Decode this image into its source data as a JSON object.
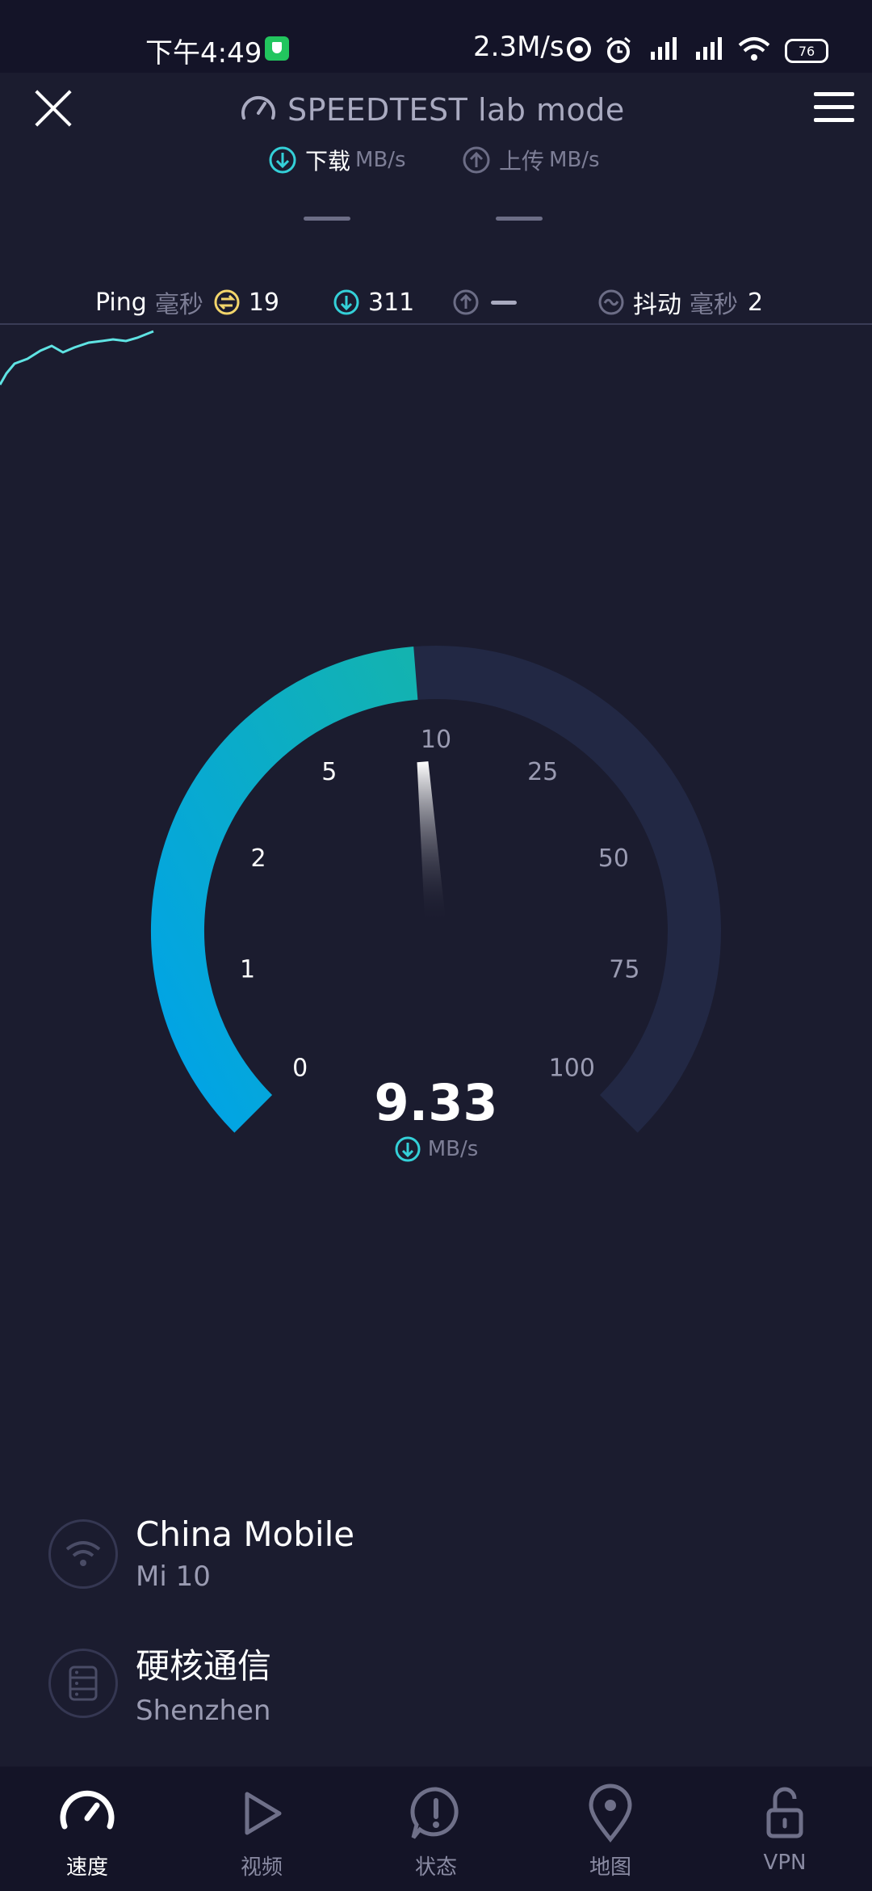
{
  "status_bar": {
    "time": "下午4:49",
    "net_speed": "2.3M/s",
    "battery": "76"
  },
  "header": {
    "title": "SPEEDTEST lab mode",
    "download_label": "下载",
    "download_unit": "MB/s",
    "upload_label": "上传",
    "upload_unit": "MB/s"
  },
  "stats": {
    "ping_label": "Ping",
    "ping_unit": "毫秒",
    "ping_value": "19",
    "download_ping": "311",
    "upload_ping": "",
    "jitter_label": "抖动",
    "jitter_unit": "毫秒",
    "jitter_value": "2"
  },
  "gauge": {
    "value": "9.33",
    "unit": "MB/s",
    "ticks": [
      "0",
      "1",
      "2",
      "5",
      "10",
      "25",
      "50",
      "75",
      "100"
    ],
    "current_speed": 9.33,
    "max": 100,
    "colors": {
      "accent_start": "#00a3e8",
      "accent_end": "#13b3b0",
      "track": "#222844"
    }
  },
  "connection": {
    "provider": "China Mobile",
    "device": "Mi 10",
    "server": "硬核通信",
    "city": "Shenzhen"
  },
  "nav": {
    "items": [
      {
        "label": "速度",
        "icon": "speedometer-icon",
        "active": true
      },
      {
        "label": "视频",
        "icon": "play-icon",
        "active": false
      },
      {
        "label": "状态",
        "icon": "alert-bubble-icon",
        "active": false
      },
      {
        "label": "地图",
        "icon": "map-pin-icon",
        "active": false
      },
      {
        "label": "VPN",
        "icon": "unlock-icon",
        "active": false
      }
    ]
  }
}
